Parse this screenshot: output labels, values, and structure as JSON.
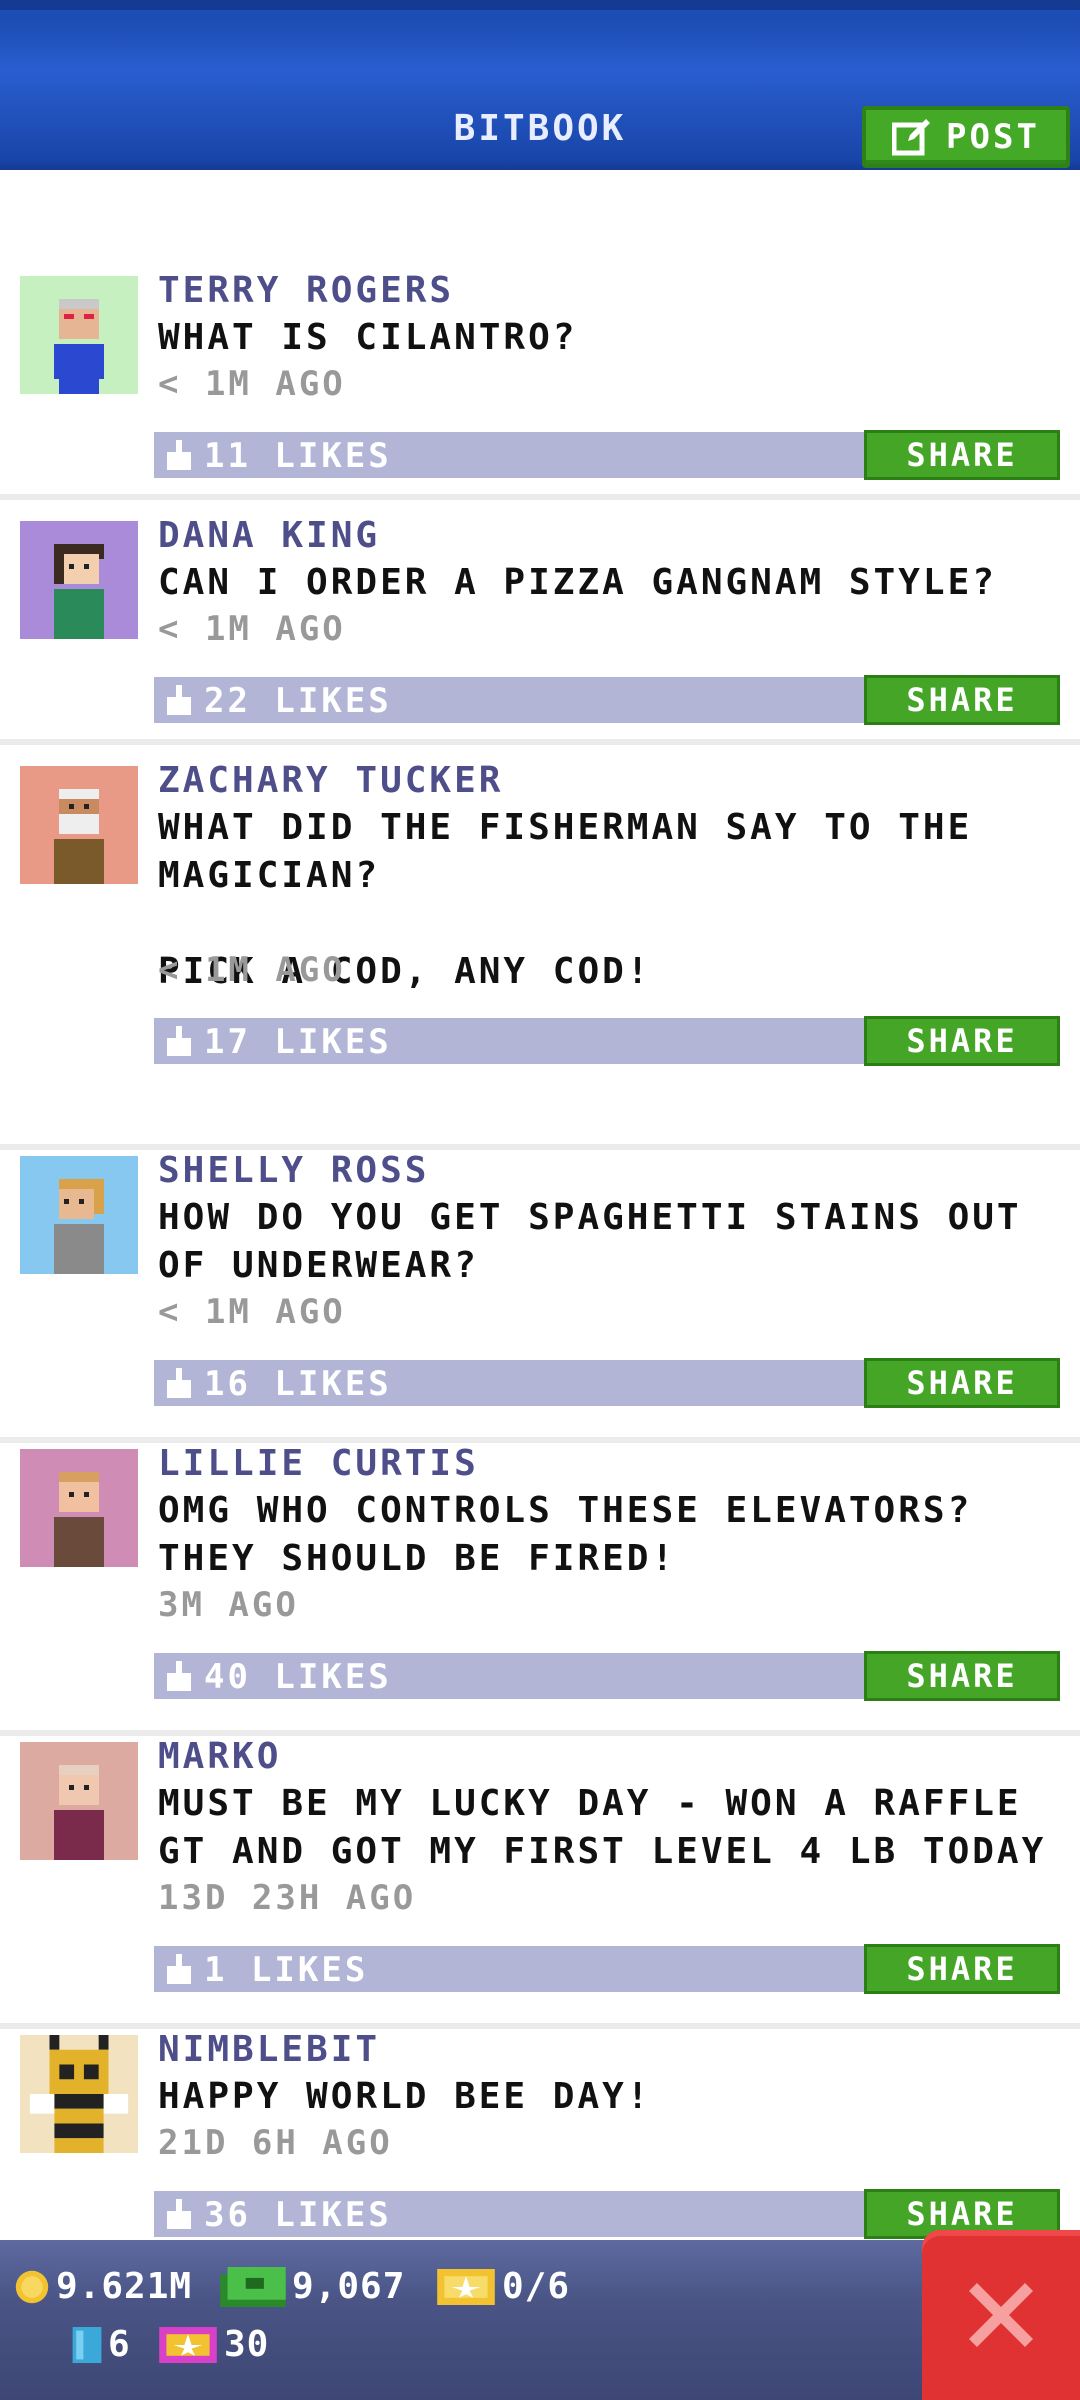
{
  "header": {
    "title": "BITBOOK",
    "post_label": "POST"
  },
  "posts": [
    {
      "name": "TERRY ROGERS",
      "text": "WHAT IS CILANTRO?",
      "time": "< 1M AGO",
      "likes": "11 LIKES",
      "share": "SHARE",
      "avatar_color": "#c6f0c0"
    },
    {
      "name": "DANA KING",
      "text": "CAN I ORDER A PIZZA GANGNAM STYLE?",
      "time": "< 1M AGO",
      "likes": "22 LIKES",
      "share": "SHARE",
      "avatar_color": "#a98bd9"
    },
    {
      "name": "ZACHARY TUCKER",
      "text": "WHAT DID THE FISHERMAN SAY TO THE MAGICIAN?\n\nPICK A COD, ANY COD!",
      "time": "< 1M AGO",
      "likes": "17 LIKES",
      "share": "SHARE",
      "avatar_color": "#e89a86"
    },
    {
      "name": "SHELLY ROSS",
      "text": "HOW DO YOU GET SPAGHETTI STAINS OUT OF UNDERWEAR?",
      "time": "< 1M AGO",
      "likes": "16 LIKES",
      "share": "SHARE",
      "avatar_color": "#86c8f0"
    },
    {
      "name": "LILLIE CURTIS",
      "text": "OMG WHO CONTROLS THESE ELEVATORS? THEY SHOULD BE FIRED!",
      "time": "3M AGO",
      "likes": "40 LIKES",
      "share": "SHARE",
      "avatar_color": "#cf8cb4"
    },
    {
      "name": "MARKO",
      "text": "MUST BE MY LUCKY DAY - WON A RAFFLE GT AND GOT MY FIRST LEVEL 4 LB TODAY",
      "time": "13D 23H AGO",
      "likes": "1 LIKES",
      "share": "SHARE",
      "avatar_color": "#dcaaa0"
    },
    {
      "name": "NIMBLEBIT",
      "text": "HAPPY WORLD BEE DAY!",
      "time": "21D 6H AGO",
      "likes": "36 LIKES",
      "share": "SHARE",
      "avatar_color": "#f2e2c0"
    }
  ],
  "status": {
    "coins": "9.621M",
    "bux": "9,067",
    "tickets": "0/6",
    "keys": "6",
    "gems": "30"
  },
  "colors": {
    "header_blue": "#1c4cb4",
    "accent_green": "#44a526",
    "likes_bar": "#b3b5d6",
    "name_purple": "#4e4e8a",
    "close_red": "#e03232"
  }
}
